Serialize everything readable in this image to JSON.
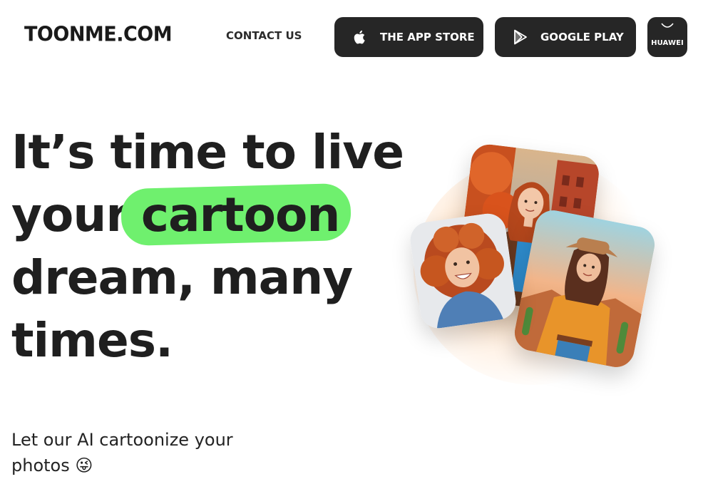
{
  "header": {
    "logo": "TOONME.COM",
    "contact_label": "CONTACT US",
    "app_store_label": "THE APP STORE",
    "google_play_label": "GOOGLE PLAY",
    "huawei_label": "HUAWEI",
    "icons": {
      "app_store": "apple-icon",
      "google_play": "google-play-icon",
      "huawei": "huawei-icon"
    }
  },
  "hero": {
    "headline_line1": "It’s time to live",
    "headline_line2_prefix": "your",
    "headline_highlight": "cartoon",
    "headline_line3": "dream, many",
    "headline_line4": "times.",
    "subtitle_line1": "Let our AI cartoonize your",
    "subtitle_line2": "photos 😜"
  },
  "colors": {
    "highlight": "#6ff06e",
    "button_bg": "#262626",
    "text": "#1f1f1f"
  }
}
